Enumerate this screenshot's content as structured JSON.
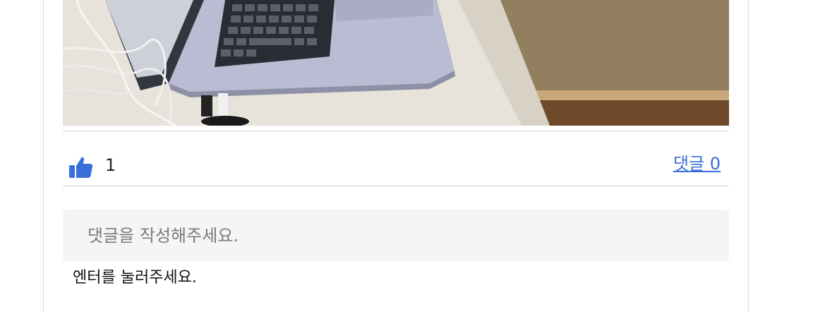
{
  "post": {
    "photo_icon": "laptop-photo",
    "like_icon": "thumbs-up-icon",
    "like_count": "1",
    "comment_link_label": "댓글 0",
    "comment_input_placeholder": "댓글을 작성해주세요.",
    "helper_text": "엔터를 눌러주세요."
  },
  "colors": {
    "accent": "#3a6fd8",
    "input_bg": "#f5f5f5",
    "divider": "#cfcfcf"
  }
}
